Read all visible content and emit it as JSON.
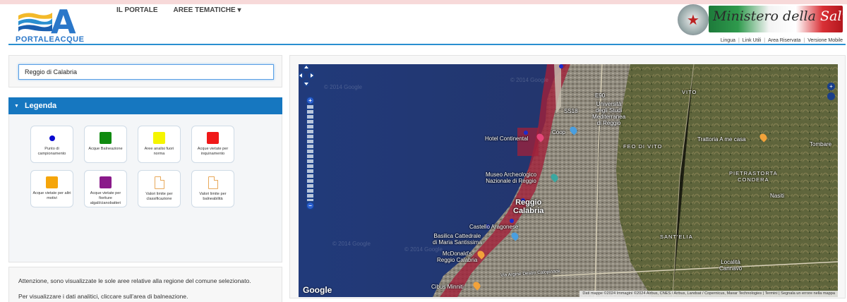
{
  "header": {
    "logo_letter": "A",
    "logo_text": "PORTALEACQUE",
    "nav": [
      {
        "label": "IL PORTALE"
      },
      {
        "label": "AREE TEMATICHE ▾"
      }
    ],
    "ministero_text_part1": "Ministero della ",
    "ministero_text_part2": "Salute",
    "utility_links": [
      "Lingua",
      "Link Utili",
      "Area Riservata",
      "Versione Mobile"
    ]
  },
  "search": {
    "value": "Reggio di Calabria"
  },
  "legend": {
    "title": "Legenda",
    "items": [
      {
        "label": "Punto di campionamento",
        "kind": "dot",
        "color": "#0a0ad0"
      },
      {
        "label": "Acque Balneazione",
        "kind": "swatch",
        "color": "#0f8a0f"
      },
      {
        "label": "Aree analisi fuori norma",
        "kind": "swatch",
        "color": "#f5f500"
      },
      {
        "label": "Acque vietate per inquinamento",
        "kind": "swatch",
        "color": "#f01818"
      },
      {
        "label": "Acque vietate per altri motivi",
        "kind": "swatch",
        "color": "#f5a50a"
      },
      {
        "label": "Acque vietate per fioriture algali/cianobatteri",
        "kind": "swatch",
        "color": "#8a1a8a"
      },
      {
        "label": "Valori limite per classificazione",
        "kind": "doc",
        "color": "#e8a85a"
      },
      {
        "label": "Valori limite per balneabilità",
        "kind": "doc",
        "color": "#e8a85a"
      }
    ]
  },
  "notes": [
    "Attenzione, sono visualizzate le sole aree relative alla regione del comune selezionato.",
    "Per visualizzare i dati analitici, cliccare sull'area di balneazione."
  ],
  "map": {
    "labels": {
      "hotel": "Hotel Continental",
      "coop": "Coop",
      "universita": "Università\ndegli Studi\nMediterranea\ndi Reggio",
      "museo": "Museo Archeologico\nNazionale di Reggio",
      "city": "Reggio\nCalabria",
      "castello": "Castello Aragonese",
      "basilica": "Basilica Cattedrale\ndi Maria Santissima",
      "mcdonalds": "McDonald's\nReggio Calabria",
      "cibus": "Cibus Minniti",
      "vito": "VITO",
      "feo": "FEO DI VITO",
      "trattoria": "Trattoria A me casa",
      "tombare": "Tombare",
      "pietrastorta": "PIETRASTORTA\nCONDERA",
      "nasiti": "Nasiti",
      "santelia": "SANT'ELIA",
      "localita": "Località\nCannavò",
      "via": "Via Argine Destro Calopinace",
      "e90": "E90",
      "ss18": "SS18"
    },
    "google": "Google",
    "attribution": "Dati mappe ©2024 Immagini ©2024 Airbus, CNES / Airbus, Landsat / Copernicus, Maxar Technologies | Termini | Segnala un errore nella mappa",
    "watermark": "© 2014 Google"
  }
}
